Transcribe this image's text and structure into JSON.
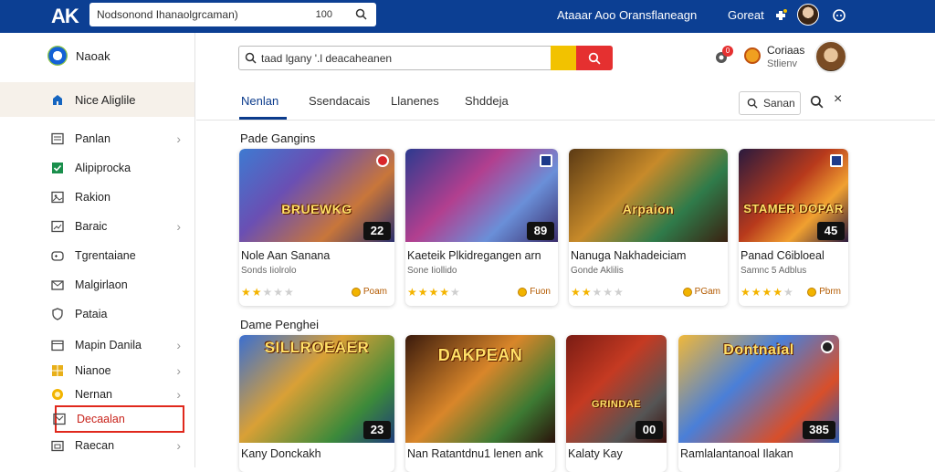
{
  "topbar": {
    "logo": "AK",
    "address": "Nodsonond Ihanaolgrcaman)",
    "zoom": "100",
    "center_label": "Ataaar Aoo Oransflaneagn",
    "right_label": "Goreat"
  },
  "sidebar": {
    "brand": "Naoak",
    "active_item": "Nice Aliglile",
    "items": [
      {
        "label": "Panlan",
        "chevron": true
      },
      {
        "label": "Alipiprocka",
        "chevron": false
      },
      {
        "label": "Rakion",
        "chevron": false
      },
      {
        "label": "Baraic",
        "chevron": true
      },
      {
        "label": "Tgrentaiane",
        "chevron": false
      },
      {
        "label": "Malgirlaon",
        "chevron": false
      },
      {
        "label": "Pataia",
        "chevron": false
      },
      {
        "label": "Mapin Danila",
        "chevron": true
      },
      {
        "label": "Nianoe",
        "chevron": true
      },
      {
        "label": "Nernan",
        "chevron": true
      },
      {
        "label": "Decaalan",
        "chevron": false
      },
      {
        "label": "Raecan",
        "chevron": true
      }
    ]
  },
  "search": {
    "value": "taad lgany '.l deacaheanen"
  },
  "user": {
    "name": "Coriaas",
    "sub": "Stlienv",
    "cart_count": "0"
  },
  "tabs": [
    {
      "label": "Nenlan",
      "active": true
    },
    {
      "label": "Ssendacais",
      "active": false
    },
    {
      "label": "Llanenes",
      "active": false
    },
    {
      "label": "Shddeja",
      "active": false
    }
  ],
  "tab_search": {
    "label": "Sanan"
  },
  "sections": [
    {
      "title": "Pade Gangins",
      "cards": [
        {
          "art_title": "BRUEWKG",
          "badge": "22",
          "name": "Nole Aan Sanana",
          "sub": "Sonds Iiolrolo",
          "rating": 2,
          "price": "Poam"
        },
        {
          "art_title": "",
          "badge": "89",
          "name": "Kaeteik Plkidregangen arn",
          "sub": "Sone Iiollido",
          "rating": 4,
          "price": "Fuon"
        },
        {
          "art_title": "Arpaion",
          "badge": "",
          "name": "Nanuga Nakhadeiciam",
          "sub": "Gonde Aklilis",
          "rating": 2,
          "price": "PGam"
        },
        {
          "art_title": "STAMER DOPAR",
          "badge": "45",
          "name": "Panad C6ibloeal",
          "sub": "Samnc 5 Adblus",
          "rating": 4,
          "price": "Pbrm"
        }
      ]
    },
    {
      "title": "Dame Penghei",
      "cards": [
        {
          "art_title": "SILLROEAER",
          "badge": "23",
          "name": "Kany Donckakh",
          "sub": "",
          "rating": 0,
          "price": ""
        },
        {
          "art_title": "DAKPEAN",
          "badge": "",
          "name": "Nan Ratantdnu1 lenen ank",
          "sub": "",
          "rating": 0,
          "price": ""
        },
        {
          "art_title": "GRINDAE",
          "badge": "00",
          "name": "Kalaty Kay",
          "sub": "",
          "rating": 0,
          "price": ""
        },
        {
          "art_title": "Dontnaial",
          "badge": "385",
          "name": "Ramlalantanoal Ilakan",
          "sub": "",
          "rating": 0,
          "price": ""
        }
      ]
    }
  ]
}
